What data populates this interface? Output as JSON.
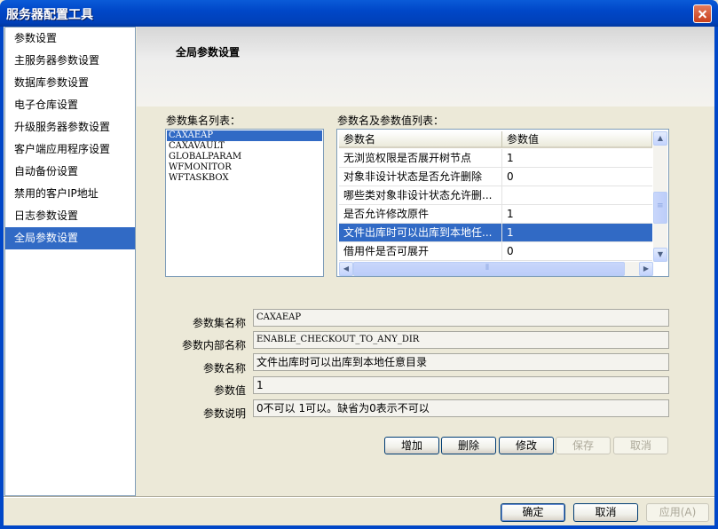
{
  "window": {
    "title": "服务器配置工具"
  },
  "sidebar": {
    "items": [
      {
        "label": "参数设置"
      },
      {
        "label": "主服务器参数设置"
      },
      {
        "label": "数据库参数设置"
      },
      {
        "label": "电子仓库设置"
      },
      {
        "label": "升级服务器参数设置"
      },
      {
        "label": "客户端应用程序设置"
      },
      {
        "label": "自动备份设置"
      },
      {
        "label": "禁用的客户IP地址"
      },
      {
        "label": "日志参数设置"
      },
      {
        "label": "全局参数设置"
      }
    ],
    "selected_index": 9
  },
  "main": {
    "header_title": "全局参数设置",
    "set_list_label": "参数集名列表：",
    "param_list_label": "参数名及参数值列表：",
    "set_list": [
      "CAXAEAP",
      "CAXAVAULT",
      "GLOBALPARAM",
      "WFMONITOR",
      "WFTASKBOX"
    ],
    "set_selected_index": 0,
    "grid": {
      "columns": [
        "参数名",
        "参数值"
      ],
      "rows": [
        {
          "name": "无浏览权限是否展开树节点",
          "value": "1"
        },
        {
          "name": "对象非设计状态是否允许删除",
          "value": "0"
        },
        {
          "name": "哪些类对象非设计状态允许删...",
          "value": ""
        },
        {
          "name": "是否允许修改原件",
          "value": "1"
        },
        {
          "name": "文件出库时可以出库到本地任...",
          "value": "1"
        },
        {
          "name": "借用件是否可展开",
          "value": "0"
        }
      ],
      "selected_index": 4
    },
    "details": {
      "set_name_label": "参数集名称",
      "set_name_value": "CAXAEAP",
      "internal_name_label": "参数内部名称",
      "internal_name_value": "ENABLE_CHECKOUT_TO_ANY_DIR",
      "param_name_label": "参数名称",
      "param_name_value": "文件出库时可以出库到本地任意目录",
      "param_value_label": "参数值",
      "param_value_value": "1",
      "description_label": "参数说明",
      "description_value": "0不可以 1可以。缺省为0表示不可以"
    },
    "actions": {
      "add": "增加",
      "delete": "删除",
      "modify": "修改",
      "save": "保存",
      "cancel": "取消"
    }
  },
  "footer": {
    "ok": "确定",
    "cancel": "取消",
    "apply": "应用(A)"
  }
}
